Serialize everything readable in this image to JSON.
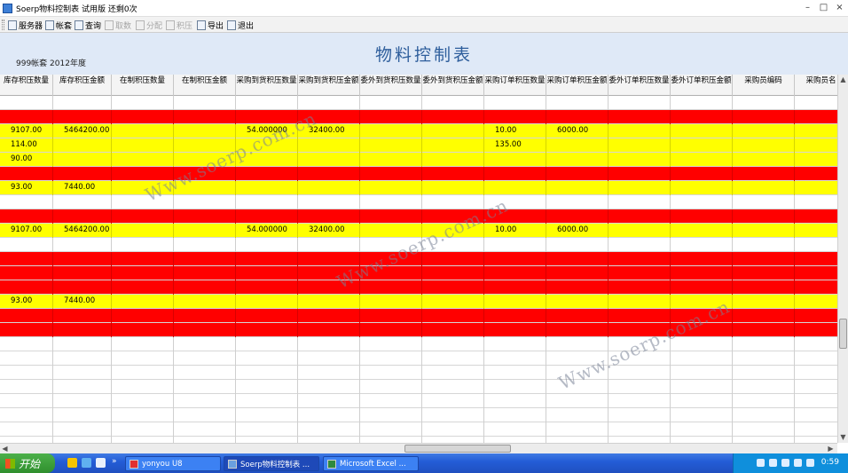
{
  "window": {
    "title": "Soerp物料控制表 试用版  还剩0次"
  },
  "toolbar": {
    "items": [
      {
        "label": "服务器",
        "enabled": true,
        "icon": "server-icon"
      },
      {
        "label": "帐套",
        "enabled": true,
        "icon": "account-icon"
      },
      {
        "label": "查询",
        "enabled": true,
        "icon": "filter-icon"
      },
      {
        "label": "取数",
        "enabled": false,
        "icon": "fetch-icon"
      },
      {
        "label": "分配",
        "enabled": false,
        "icon": "allocate-icon"
      },
      {
        "label": "积压",
        "enabled": false,
        "icon": "backlog-icon"
      },
      {
        "label": "导出",
        "enabled": true,
        "icon": "export-icon"
      },
      {
        "label": "退出",
        "enabled": true,
        "icon": "exit-icon"
      }
    ]
  },
  "report": {
    "title": "物料控制表",
    "subtitle": "999帐套 2012年度"
  },
  "colors": {
    "red_row": "#ff0000",
    "yellow_row": "#ffff00",
    "header_panel": "#dfe9f7",
    "title_text": "#2e5e9c"
  },
  "table": {
    "columns": [
      "库存积压数量",
      "库存积压金额",
      "在制积压数量",
      "在制积压金额",
      "采购到货积压数量",
      "采购到货积压金额",
      "委外到货积压数量",
      "委外到货积压金额",
      "采购订单积压数量",
      "采购订单积压金额",
      "委外订单积压数量",
      "委外订单积压金额",
      "采购员编码",
      "采购员名"
    ],
    "rows": [
      {
        "color": "white",
        "cells": [
          "",
          "",
          "",
          "",
          "",
          "",
          "",
          "",
          "",
          "",
          "",
          "",
          "",
          ""
        ]
      },
      {
        "color": "red",
        "cells": [
          "",
          "",
          "",
          "",
          "",
          "",
          "",
          "",
          "",
          "",
          "",
          "",
          "",
          ""
        ]
      },
      {
        "color": "yellow",
        "cells": [
          "9107.00",
          "5464200.00",
          "",
          "",
          "54.000000",
          "32400.00",
          "",
          "",
          "10.00",
          "6000.00",
          "",
          "",
          "",
          ""
        ]
      },
      {
        "color": "yellow",
        "cells": [
          "114.00",
          "",
          "",
          "",
          "",
          "",
          "",
          "",
          "135.00",
          "",
          "",
          "",
          "",
          ""
        ]
      },
      {
        "color": "yellow",
        "cells": [
          "90.00",
          "",
          "",
          "",
          "",
          "",
          "",
          "",
          "",
          "",
          "",
          "",
          "",
          ""
        ]
      },
      {
        "color": "red",
        "cells": [
          "",
          "",
          "",
          "",
          "",
          "",
          "",
          "",
          "",
          "",
          "",
          "",
          "",
          ""
        ]
      },
      {
        "color": "yellow",
        "cells": [
          "93.00",
          "7440.00",
          "",
          "",
          "",
          "",
          "",
          "",
          "",
          "",
          "",
          "",
          "",
          ""
        ]
      },
      {
        "color": "white",
        "cells": [
          "",
          "",
          "",
          "",
          "",
          "",
          "",
          "",
          "",
          "",
          "",
          "",
          "",
          ""
        ]
      },
      {
        "color": "red",
        "cells": [
          "",
          "",
          "",
          "",
          "",
          "",
          "",
          "",
          "",
          "",
          "",
          "",
          "",
          ""
        ]
      },
      {
        "color": "yellow",
        "cells": [
          "9107.00",
          "5464200.00",
          "",
          "",
          "54.000000",
          "32400.00",
          "",
          "",
          "10.00",
          "6000.00",
          "",
          "",
          "",
          ""
        ]
      },
      {
        "color": "white",
        "cells": [
          "",
          "",
          "",
          "",
          "",
          "",
          "",
          "",
          "",
          "",
          "",
          "",
          "",
          ""
        ]
      },
      {
        "color": "red",
        "cells": [
          "",
          "",
          "",
          "",
          "",
          "",
          "",
          "",
          "",
          "",
          "",
          "",
          "",
          ""
        ]
      },
      {
        "color": "red",
        "cells": [
          "",
          "",
          "",
          "",
          "",
          "",
          "",
          "",
          "",
          "",
          "",
          "",
          "",
          ""
        ]
      },
      {
        "color": "red",
        "cells": [
          "",
          "",
          "",
          "",
          "",
          "",
          "",
          "",
          "",
          "",
          "",
          "",
          "",
          ""
        ]
      },
      {
        "color": "yellow",
        "cells": [
          "93.00",
          "7440.00",
          "",
          "",
          "",
          "",
          "",
          "",
          "",
          "",
          "",
          "",
          "",
          ""
        ]
      },
      {
        "color": "red",
        "cells": [
          "",
          "",
          "",
          "",
          "",
          "",
          "",
          "",
          "",
          "",
          "",
          "",
          "",
          ""
        ]
      },
      {
        "color": "red",
        "cells": [
          "",
          "",
          "",
          "",
          "",
          "",
          "",
          "",
          "",
          "",
          "",
          "",
          "",
          ""
        ]
      },
      {
        "color": "white",
        "cells": [
          "",
          "",
          "",
          "",
          "",
          "",
          "",
          "",
          "",
          "",
          "",
          "",
          "",
          ""
        ]
      },
      {
        "color": "white",
        "cells": [
          "",
          "",
          "",
          "",
          "",
          "",
          "",
          "",
          "",
          "",
          "",
          "",
          "",
          ""
        ]
      },
      {
        "color": "white",
        "cells": [
          "",
          "",
          "",
          "",
          "",
          "",
          "",
          "",
          "",
          "",
          "",
          "",
          "",
          ""
        ]
      },
      {
        "color": "white",
        "cells": [
          "",
          "",
          "",
          "",
          "",
          "",
          "",
          "",
          "",
          "",
          "",
          "",
          "",
          ""
        ]
      },
      {
        "color": "white",
        "cells": [
          "",
          "",
          "",
          "",
          "",
          "",
          "",
          "",
          "",
          "",
          "",
          "",
          "",
          ""
        ]
      },
      {
        "color": "white",
        "cells": [
          "",
          "",
          "",
          "",
          "",
          "",
          "",
          "",
          "",
          "",
          "",
          "",
          "",
          ""
        ]
      },
      {
        "color": "white",
        "cells": [
          "",
          "",
          "",
          "",
          "",
          "",
          "",
          "",
          "",
          "",
          "",
          "",
          "",
          ""
        ]
      },
      {
        "color": "white",
        "cells": [
          "",
          "",
          "",
          "",
          "",
          "",
          "",
          "",
          "",
          "",
          "",
          "",
          "",
          ""
        ]
      }
    ]
  },
  "watermarks": [
    "Www.soerp.com.cn",
    "Www.soerp.com.cn",
    "Www.soerp.com.cn"
  ],
  "taskbar": {
    "start_label": "开始",
    "tasks": [
      {
        "label": "yonyou U8",
        "active": false
      },
      {
        "label": "Soerp物料控制表 ...",
        "active": true
      },
      {
        "label": "Microsoft Excel ...",
        "active": false
      }
    ],
    "clock": "0:59"
  }
}
